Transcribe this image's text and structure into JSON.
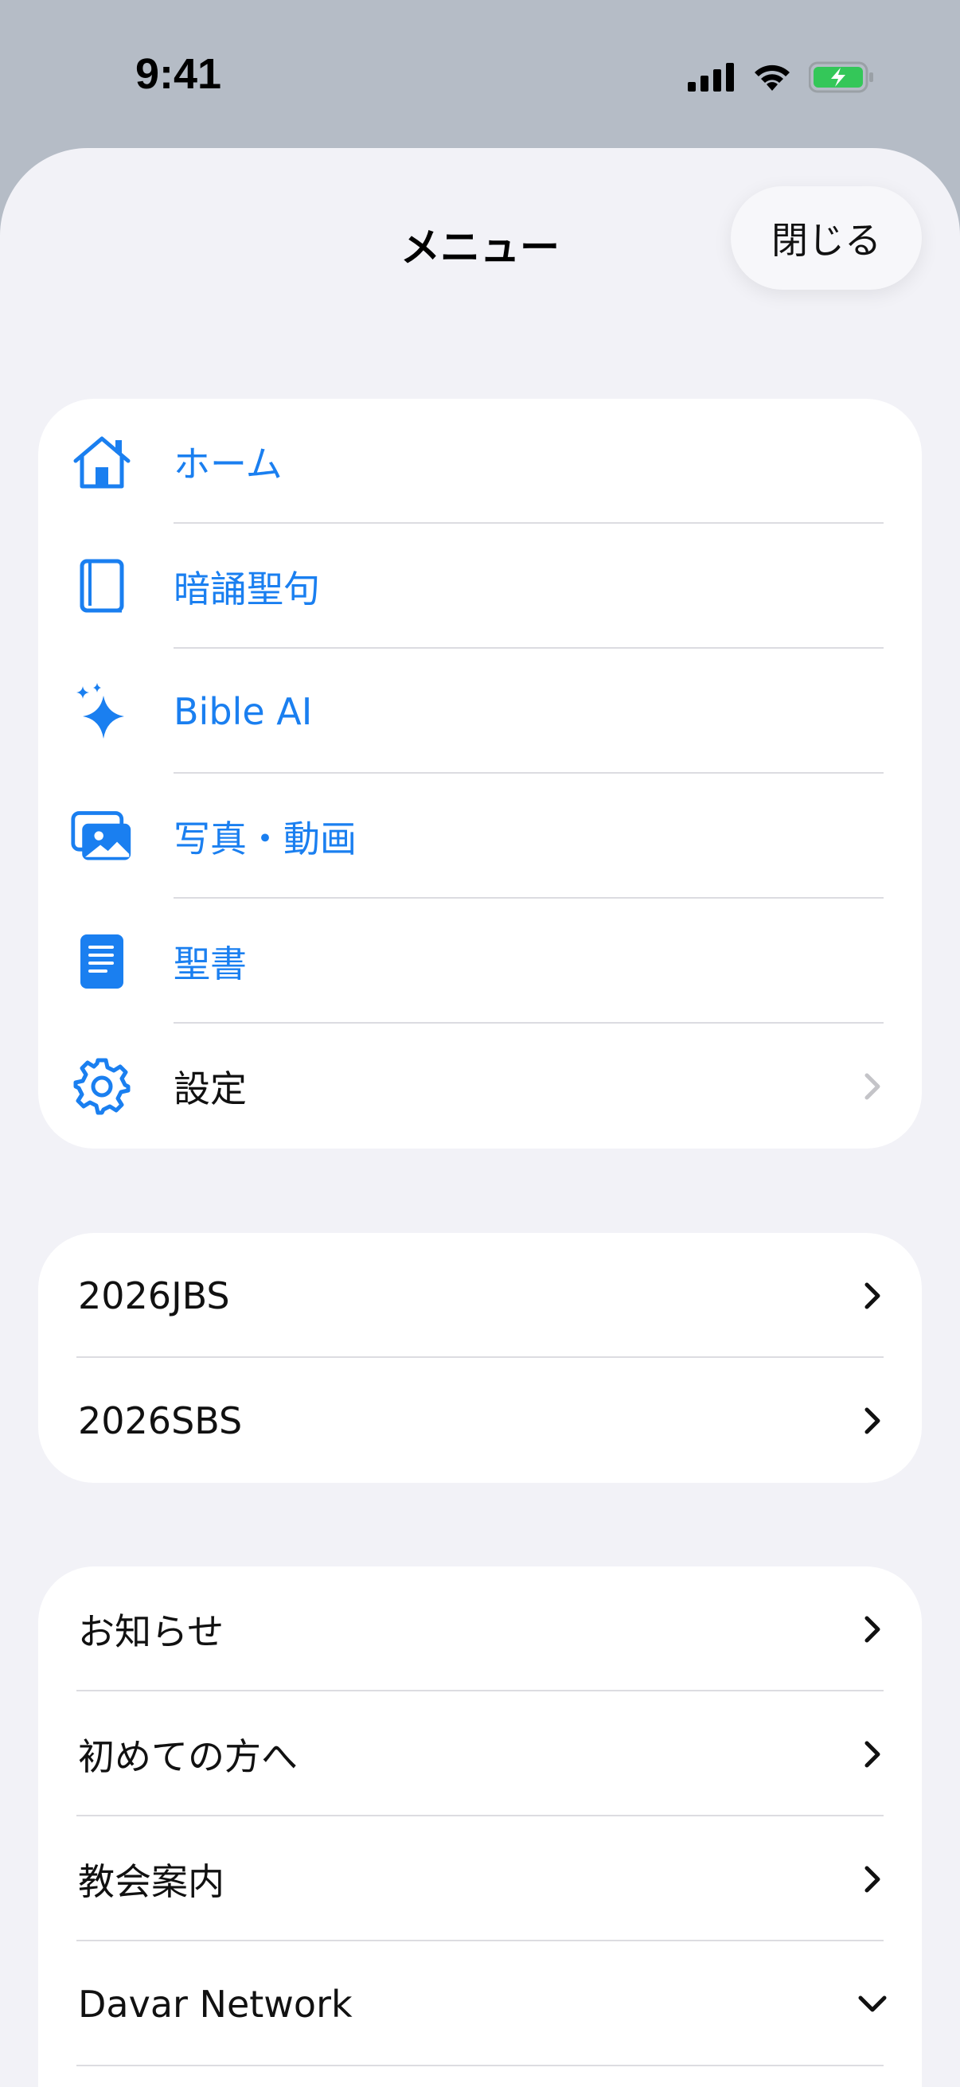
{
  "status": {
    "time": "9:41"
  },
  "header": {
    "title": "メニュー",
    "close_label": "閉じる"
  },
  "colors": {
    "accent": "#1a7ff0",
    "battery": "#34c759"
  },
  "group1": [
    {
      "label": "ホーム",
      "icon": "home-icon"
    },
    {
      "label": "暗誦聖句",
      "icon": "book-icon"
    },
    {
      "label": "Bible AI",
      "icon": "sparkles-icon"
    },
    {
      "label": "写真・動画",
      "icon": "photos-icon"
    },
    {
      "label": "聖書",
      "icon": "bible-icon"
    },
    {
      "label": "設定",
      "icon": "gear-icon"
    }
  ],
  "group2": [
    {
      "label": "2026JBS"
    },
    {
      "label": "2026SBS"
    }
  ],
  "group3": [
    {
      "label": "お知らせ"
    },
    {
      "label": "初めての方へ"
    },
    {
      "label": "教会案内"
    },
    {
      "label": "Davar Network"
    }
  ]
}
